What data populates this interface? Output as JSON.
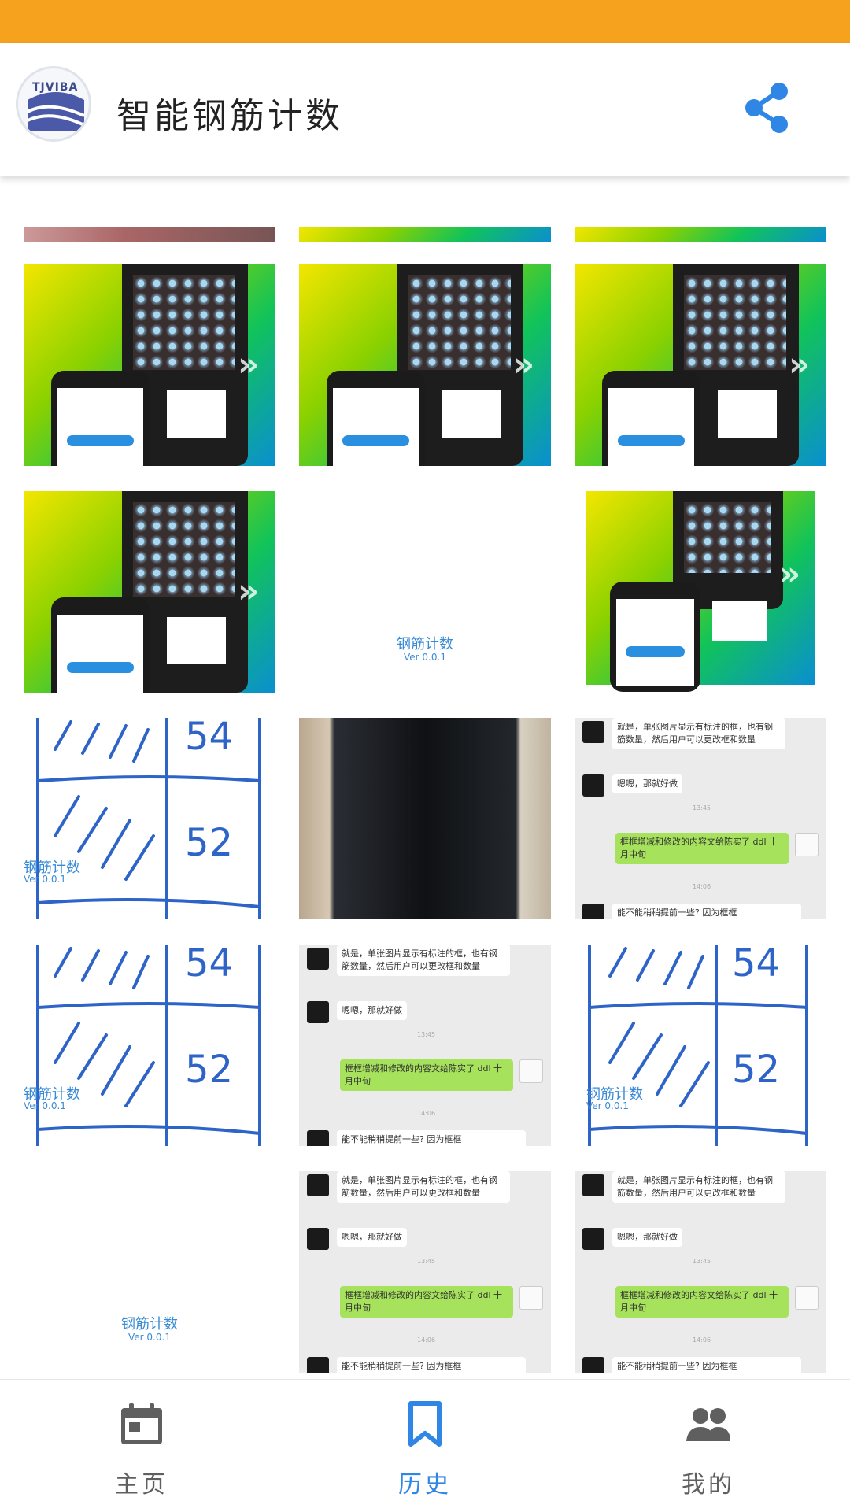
{
  "app_bar": {
    "title": "智能钢筋计数",
    "logo_text": "TJVIBA"
  },
  "placeholder": {
    "title": "钢筋计数",
    "version": "Ver 0.0.1"
  },
  "promo_card": {
    "app_name": "钢筋计数"
  },
  "chat": {
    "msg1": "就是，单张图片显示有标注的框，也有钢筋数量，然后用户可以更改框和数量",
    "msg2": "嗯嗯，那就好做",
    "msg3": "框框增减和修改的内容文给陈实了 ddl 十月中旬",
    "msg4": "能不能稍稍提前一些? 因为框框"
  },
  "sketch": {
    "num_top": "54",
    "num_mid": "52"
  },
  "bottom_nav": {
    "items": [
      {
        "label": "主页",
        "icon": "calendar-icon",
        "active": false
      },
      {
        "label": "历史",
        "icon": "bookmark-icon",
        "active": true
      },
      {
        "label": "我的",
        "icon": "people-icon",
        "active": false
      }
    ]
  },
  "colors": {
    "status_bar": "#f7a21f",
    "accent": "#2f86e5",
    "inactive": "#666666"
  }
}
